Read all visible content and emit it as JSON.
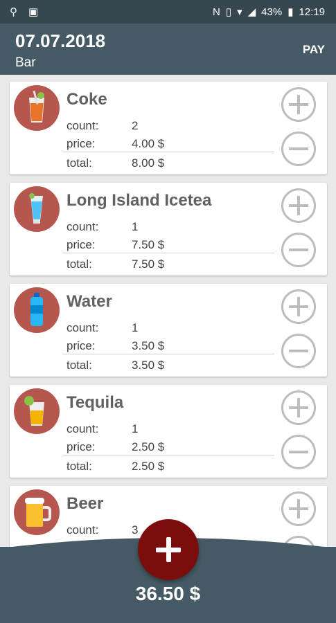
{
  "status_bar": {
    "battery": "43%",
    "time": "12:19",
    "icons": [
      "usb-icon",
      "android-icon",
      "nfc-icon",
      "vibrate-icon",
      "wifi-icon",
      "signal-icon",
      "battery-icon"
    ]
  },
  "header": {
    "date": "07.07.2018",
    "location": "Bar",
    "pay_label": "PAY"
  },
  "labels": {
    "count": "count:",
    "price": "price:",
    "total": "total:"
  },
  "items": [
    {
      "name": "Coke",
      "count": "2",
      "price": "4.00 $",
      "total": "8.00 $",
      "icon": "coke-glass-icon"
    },
    {
      "name": "Long Island Icetea",
      "count": "1",
      "price": "7.50 $",
      "total": "7.50 $",
      "icon": "cocktail-icon"
    },
    {
      "name": "Water",
      "count": "1",
      "price": "3.50 $",
      "total": "3.50 $",
      "icon": "water-bottle-icon"
    },
    {
      "name": "Tequila",
      "count": "1",
      "price": "2.50 $",
      "total": "2.50 $",
      "icon": "tequila-shot-icon"
    },
    {
      "name": "Beer",
      "count": "3",
      "price": "",
      "total": "",
      "icon": "beer-mug-icon"
    }
  ],
  "grand_total": "36.50 $",
  "colors": {
    "appbar": "#455a64",
    "statusbar": "#37474f",
    "avatar": "#b5564f",
    "fab": "#7b0d0d"
  }
}
